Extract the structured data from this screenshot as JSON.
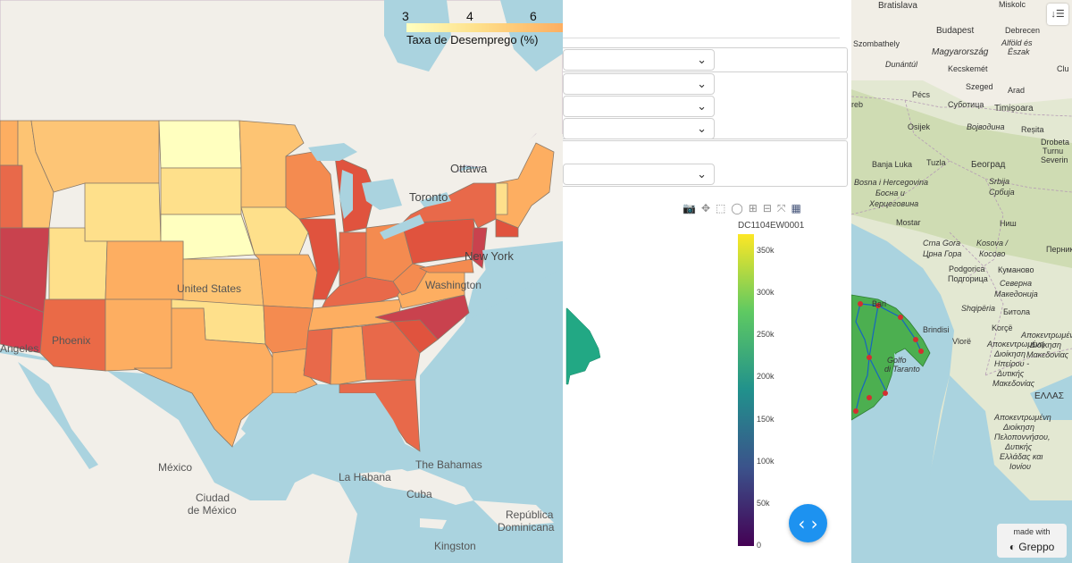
{
  "left_map": {
    "legend": {
      "title": "Taxa de Desemprego (%)",
      "ticks": [
        "3",
        "4",
        "6"
      ],
      "colors": [
        "#ffffbf",
        "#fee08b",
        "#fdae61",
        "#f46d43",
        "#d53e4f"
      ]
    },
    "labels": {
      "ottawa": "Ottawa",
      "toronto": "Toronto",
      "new_york": "New York",
      "washington": "Washington",
      "united_states": "United States",
      "phoenix": "Phoenix",
      "los_angeles": "Angeles",
      "mexico": "México",
      "ciudad": "Ciudad",
      "de_mexico": "de México",
      "la_habana": "La Habana",
      "the_bahamas": "The Bahamas",
      "cuba": "Cuba",
      "republica": "República",
      "dominicana": "Dominicana",
      "kingston": "Kingston"
    }
  },
  "middle_panel": {
    "modebar_icons": [
      "camera-icon",
      "pan-icon",
      "box-select-icon",
      "lasso-icon",
      "zoom-in-icon",
      "zoom-out-icon",
      "autoscale-icon",
      "plotly-logo-icon"
    ],
    "colorbar": {
      "title": "DC1104EW0001",
      "ticks": [
        "350k",
        "300k",
        "250k",
        "200k",
        "150k",
        "100k",
        "50k",
        "0"
      ],
      "max": 370000,
      "colorscale": "Viridis"
    },
    "fab_label": "‹ ›"
  },
  "right_map": {
    "labels": {
      "bratislava": "Bratislava",
      "miskolc": "Miskolc",
      "budapest": "Budapest",
      "debrecen": "Debrecen",
      "szombathely": "Szombathely",
      "magyarorszag": "Magyarország",
      "alfold": "Alföld és",
      "eszak": "Észak",
      "dunantul": "Dunántúl",
      "kecskemet": "Kecskemét",
      "cluj": "Clu",
      "szeged": "Szeged",
      "arad": "Arad",
      "pecs": "Pécs",
      "subotica": "Суботица",
      "timisoara": "Timișoara",
      "reb": "reb",
      "osijek": "Osijek",
      "vojvodina": "Војводина",
      "resita": "Reșita",
      "banja_luka": "Banja Luka",
      "tuzla": "Tuzla",
      "beograd": "Београд",
      "drobeta1": "Drobeta",
      "drobeta2": "Turnu",
      "drobeta3": "Severin",
      "bih1": "Bosna i Hercegovina",
      "bih2": "Босна и",
      "bih3": "Херцеговина",
      "srbija1": "Srbija",
      "srbija2": "Србија",
      "mostar": "Mostar",
      "nis": "Ниш",
      "cg1": "Crna Gora",
      "cg2": "Црна Гора",
      "kosovo1": "Kosova /",
      "kosovo2": "Косово",
      "pernik": "Перник",
      "podgorica1": "Podgorica",
      "podgorica2": "Подгорица",
      "kumanovo": "Куманово",
      "bari": "Bari",
      "sm1": "Северна",
      "sm2": "Македонија",
      "brindisi": "Brindisi",
      "shqiperia": "Shqipëria",
      "bitola": "Битола",
      "taranto1": "Golfo",
      "taranto2": "di Taranto",
      "vlore": "Vlorë",
      "korce": "Korçë",
      "mak1": "Αποκεντρωμένη",
      "mak2": "Διοίκηση",
      "mak3": "Μακεδονίας",
      "ep1": "Αποκεντρωμένη",
      "ep2": "Διοίκηση",
      "ep3": "Ηπείρου -",
      "ep4": "Δυτικής",
      "ep5": "Μακεδονίας",
      "ellas": "ΕΛΛΑΣ",
      "pel1": "Αποκεντρωμένη",
      "pel2": "Διοίκηση",
      "pel3": "Πελοποννήσου,",
      "pel4": "Δυτικής",
      "pel5": "Ελλάδας και",
      "pel6": "Ιονίου"
    },
    "badge_top": "made with",
    "badge_name": "Greppo",
    "menu_icon": "↓☰"
  }
}
